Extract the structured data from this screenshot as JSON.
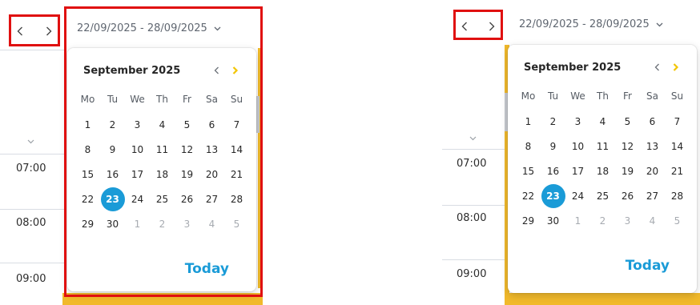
{
  "date_range": "22/09/2025 - 28/09/2025",
  "calendar": {
    "month_title": "September 2025",
    "weekdays": [
      "Mo",
      "Tu",
      "We",
      "Th",
      "Fr",
      "Sa",
      "Su"
    ],
    "weeks": [
      [
        "1",
        "2",
        "3",
        "4",
        "5",
        "6",
        "7"
      ],
      [
        "8",
        "9",
        "10",
        "11",
        "12",
        "13",
        "14"
      ],
      [
        "15",
        "16",
        "17",
        "18",
        "19",
        "20",
        "21"
      ],
      [
        "22",
        "23",
        "24",
        "25",
        "26",
        "27",
        "28"
      ],
      [
        "29",
        "30",
        "1",
        "2",
        "3",
        "4",
        "5"
      ]
    ],
    "selected_day": "23",
    "today_label": "Today"
  },
  "times": [
    "07:00",
    "08:00",
    "09:00"
  ],
  "icons": {
    "prev": "chevron-left-icon",
    "next": "chevron-right-icon",
    "dropdown": "chevron-down-icon",
    "cal_prev": "chevron-left-icon",
    "cal_next": "chevron-right-icon"
  },
  "colors": {
    "accent": "#1a9bd7",
    "highlight": "#e01010",
    "amber": "#f1b92b",
    "next_arrow": "#f2c500"
  }
}
